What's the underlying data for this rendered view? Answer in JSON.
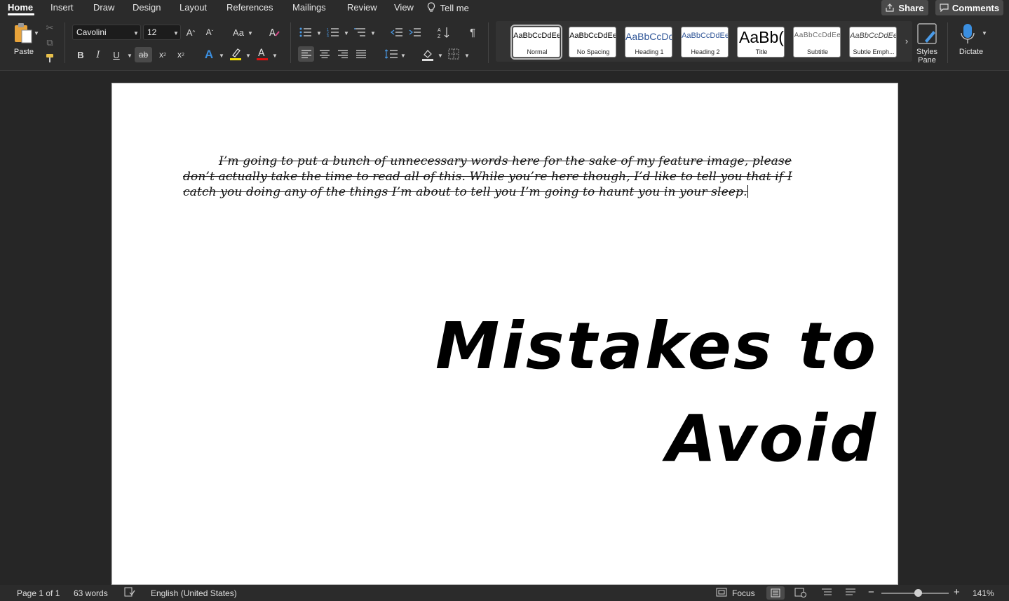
{
  "tabs": [
    "Home",
    "Insert",
    "Draw",
    "Design",
    "Layout",
    "References",
    "Mailings",
    "Review",
    "View",
    "Tell me"
  ],
  "share_label": "Share",
  "comments_label": "Comments",
  "clipboard": {
    "paste_label": "Paste"
  },
  "font": {
    "family": "Cavolini",
    "size": "12"
  },
  "styles": [
    {
      "preview": "AaBbCcDdEe",
      "name": "Normal"
    },
    {
      "preview": "AaBbCcDdEe",
      "name": "No Spacing"
    },
    {
      "preview": "AaBbCcDc",
      "name": "Heading 1"
    },
    {
      "preview": "AaBbCcDdEe",
      "name": "Heading 2"
    },
    {
      "preview": "AaBb(",
      "name": "Title"
    },
    {
      "preview": "AaBbCcDdEe",
      "name": "Subtitle"
    },
    {
      "preview": "AaBbCcDdEe",
      "name": "Subtle Emph..."
    }
  ],
  "styles_pane_label": "Styles Pane",
  "dictate_label": "Dictate",
  "document": {
    "body": "I’m going to put a bunch of unnecessary words here for the sake of my feature image, please don’t actually take the time to read all of this. While you’re here though, I’d like to tell you that if I catch you doing any of the things I’m about to tell you I’m going to haunt you in your sleep.",
    "title_line1": "Mistakes to",
    "title_line2": "Avoid"
  },
  "status": {
    "page": "Page 1 of 1",
    "words": "63 words",
    "language": "English (United States)",
    "focus": "Focus",
    "zoom": "141%"
  },
  "colors": {
    "highlight": "#f5e000",
    "font_color": "#e01010",
    "text_effects": "#3b8fe0"
  }
}
